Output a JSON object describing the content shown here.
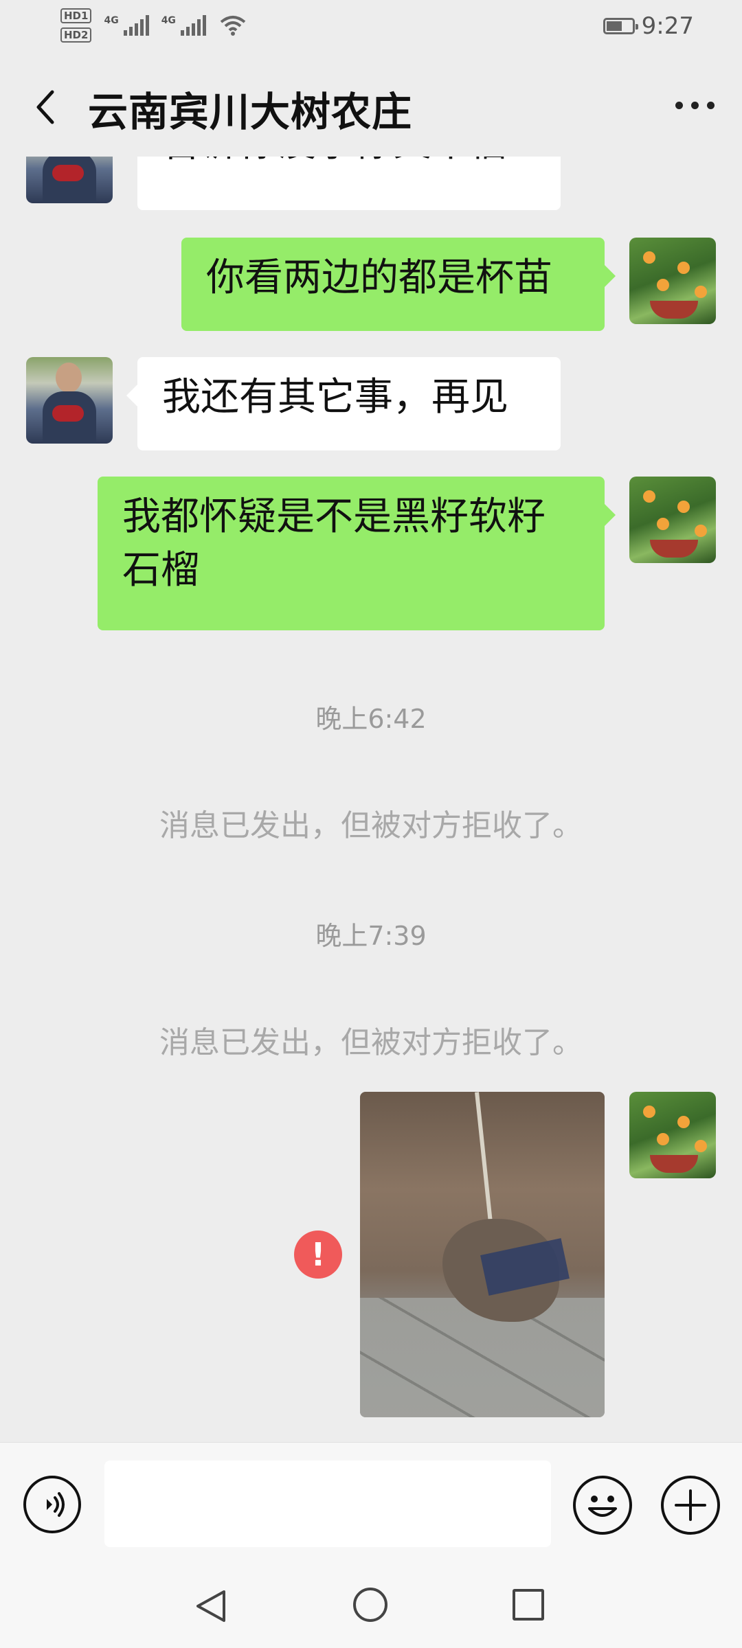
{
  "status_bar": {
    "hd_labels": [
      "HD1",
      "HD2"
    ],
    "network_labels": [
      "4G",
      "4G"
    ],
    "time": "9:27",
    "battery_level": 0.55
  },
  "header": {
    "title": "云南宾川大树农庄",
    "back_icon": "chevron-left-icon",
    "more_icon": "more-dots-icon"
  },
  "messages": [
    {
      "side": "other",
      "text": "告诉你没事你又不信",
      "avatar": "contact-avatar"
    },
    {
      "side": "me",
      "text": "你看两边的都是杯苗",
      "avatar": "my-avatar"
    },
    {
      "side": "other",
      "text": "我还有其它事，再见",
      "avatar": "contact-avatar"
    },
    {
      "side": "me",
      "text": "我都怀疑是不是黑籽软籽石榴",
      "avatar": "my-avatar"
    }
  ],
  "system": [
    {
      "time": "晚上6:42",
      "notice": "消息已发出，但被对方拒收了。"
    },
    {
      "time": "晚上7:39",
      "notice": "消息已发出，但被对方拒收了。"
    }
  ],
  "photo_message": {
    "side": "me",
    "error_symbol": "!",
    "image_icon": "photo-image"
  },
  "input_bar": {
    "voice_icon": "voice-icon",
    "input_value": "",
    "emoji_icon": "emoji-icon",
    "plus_icon": "plus-icon"
  },
  "nav_bar": {
    "back_icon": "nav-back-icon",
    "home_icon": "nav-home-icon",
    "recent_icon": "nav-recent-icon"
  }
}
